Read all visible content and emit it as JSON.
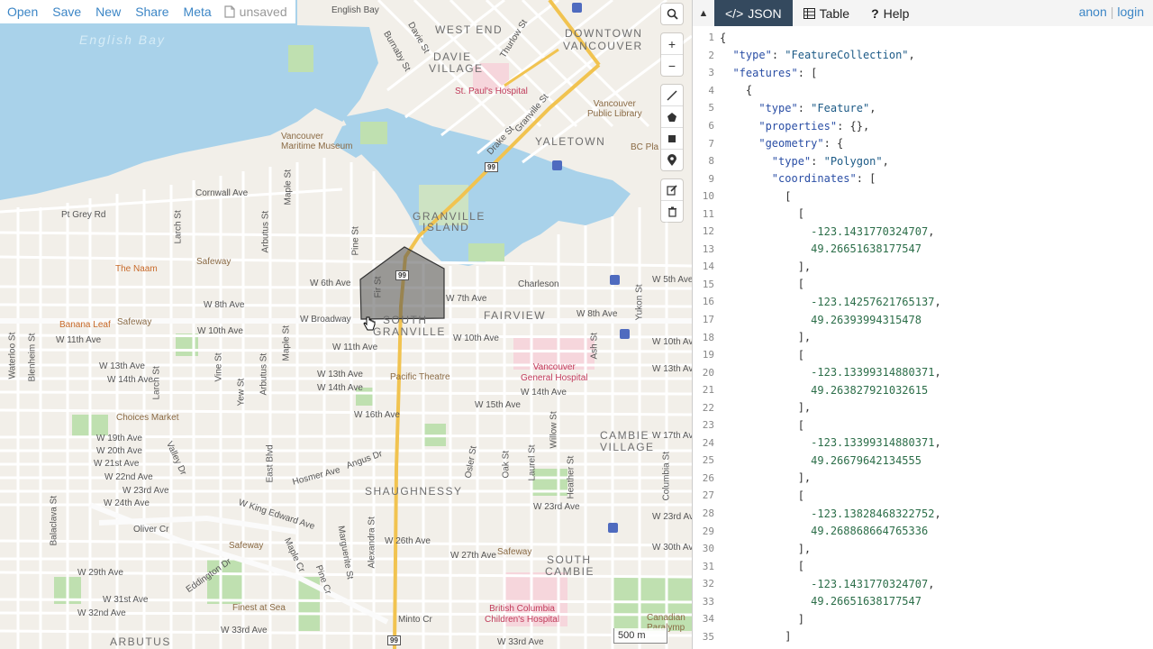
{
  "topbar": {
    "open": "Open",
    "save": "Save",
    "new": "New",
    "share": "Share",
    "meta": "Meta",
    "status": "unsaved"
  },
  "map_controls": {
    "search_icon": "search-icon",
    "zoom_in": "+",
    "zoom_out": "−",
    "draw_tools": [
      "draw-line-icon",
      "draw-polygon-icon",
      "draw-rectangle-icon",
      "draw-marker-icon"
    ],
    "edit_tools": [
      "edit-icon",
      "trash-icon"
    ]
  },
  "scale": "500 m",
  "map_labels": {
    "areas": [
      "WEST END",
      "DOWNTOWN",
      "VANCOUVER",
      "DAVIE",
      "VILLAGE",
      "YALETOWN",
      "GRANVILLE",
      "ISLAND",
      "FAIRVIEW",
      "SOUTH",
      "GRANVILLE",
      "CAMBIE",
      "VILLAGE",
      "SHAUGHNESSY",
      "SOUTH",
      "CAMBIE",
      "ARBUTUS"
    ],
    "water": "English Bay",
    "pois": [
      "Vancouver Maritime Museum",
      "St. Paul's Hospital",
      "Vancouver Public Library",
      "BC Place",
      "The Naam",
      "Safeway",
      "Banana Leaf",
      "Safeway",
      "Choices Market",
      "Pacific Theatre",
      "Vancouver General Hospital",
      "Safeway",
      "Finest at Sea",
      "Safeway",
      "British Columbia Children's Hospital",
      "Charleson",
      "Canadian Paralympic"
    ],
    "streets": [
      "Cornwall Ave",
      "Pt Grey Rd",
      "W 4th Ave",
      "W 6th Ave",
      "W 7th Ave",
      "W 8th Ave",
      "W Broadway",
      "W 10th Ave",
      "W 11th Ave",
      "W 12th Ave",
      "W 13th Ave",
      "W 14th Ave",
      "W 15th Ave",
      "W 16th Ave",
      "W 19th Ave",
      "W 20th Ave",
      "W 21st Ave",
      "W 22nd Ave",
      "W 23rd Ave",
      "W 24th Ave",
      "W 26th Ave",
      "W 27th Ave",
      "W 29th Ave",
      "W 31st Ave",
      "W 32nd Ave",
      "W 33rd Ave",
      "W King Edward Ave",
      "Oliver Cr",
      "Hosmer Ave",
      "Angus Dr",
      "Minto Cr",
      "Eddington Dr",
      "W 5th Ave",
      "W 10th Ave",
      "W 13th Ave",
      "W 17th Ave",
      "W 23rd Ave",
      "W 28th Ave",
      "W 26th Ave",
      "W 30th Ave",
      "W 33rd Ave",
      "Davie St",
      "Burnaby St",
      "Thurlow St",
      "Granville St",
      "Drake St",
      "Maple St",
      "Larch St",
      "Arbutus St",
      "Pine St",
      "Fir St",
      "Yukon St",
      "Ash St",
      "Balaclava St",
      "Blenheim St",
      "Waterloo St",
      "Vine St",
      "Yew St",
      "East Blvd",
      "Valley Dr",
      "Maple Cr",
      "Pine Cr",
      "Marguerite St",
      "Osler St",
      "Oak St",
      "Laurel St",
      "Willow St",
      "Heather St",
      "Columbia St",
      "Alexandra St",
      "Arbutus St",
      "Granville St",
      "English Bay"
    ],
    "highway": "99"
  },
  "panel": {
    "tabs": [
      {
        "label": "JSON",
        "icon": "code-icon"
      },
      {
        "label": "Table",
        "icon": "table-icon"
      },
      {
        "label": "Help",
        "icon": "help-icon"
      }
    ],
    "auth": {
      "anon": "anon",
      "login": "login"
    }
  },
  "editor_lines": [
    "{",
    "  \"type\": \"FeatureCollection\",",
    "  \"features\": [",
    "    {",
    "      \"type\": \"Feature\",",
    "      \"properties\": {},",
    "      \"geometry\": {",
    "        \"type\": \"Polygon\",",
    "        \"coordinates\": [",
    "          [",
    "            [",
    "              -123.1431770324707,",
    "              49.26651638177547",
    "            ],",
    "            [",
    "              -123.14257621765137,",
    "              49.26393994315478",
    "            ],",
    "            [",
    "              -123.13399314880371,",
    "              49.263827921032615",
    "            ],",
    "            [",
    "              -123.13399314880371,",
    "              49.26679642134555",
    "            ],",
    "            [",
    "              -123.13828468322752,",
    "              49.268868664765336",
    "            ],",
    "            [",
    "              -123.1431770324707,",
    "              49.26651638177547",
    "            ]",
    "          ]"
  ]
}
